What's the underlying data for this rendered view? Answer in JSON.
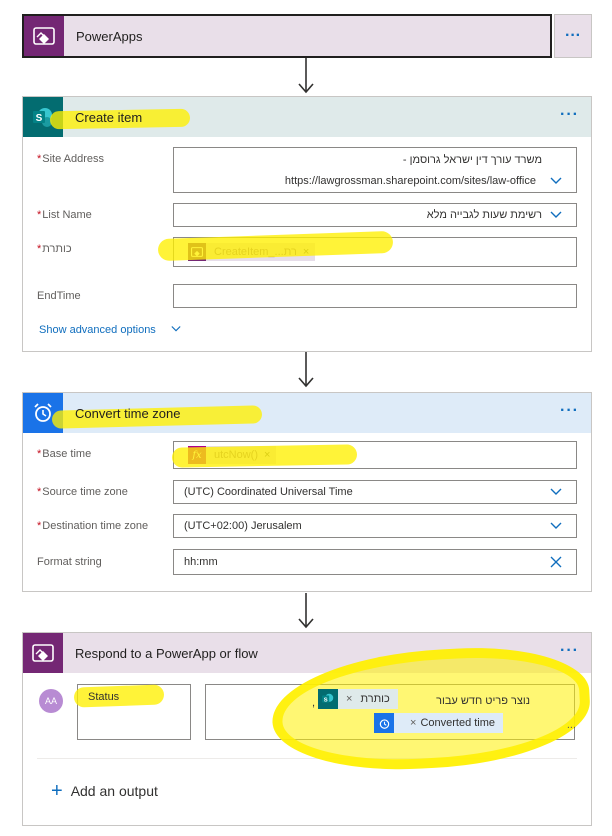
{
  "trigger": {
    "title": "PowerApps",
    "more": "···"
  },
  "create_item": {
    "title": "Create item",
    "more": "···",
    "site_address": {
      "label": "Site Address",
      "line1": "משרד עורך דין ישראל גרוסמן -",
      "line2": "https://lawgrossman.sharepoint.com/sites/law-office"
    },
    "list_name": {
      "label": "List Name",
      "value": "רשימת שעות לגבייה מלא"
    },
    "title_field": {
      "label": "כותרת",
      "token": "CreateItem_...רת"
    },
    "end_time": {
      "label": "EndTime",
      "value": ""
    },
    "advanced": "Show advanced options"
  },
  "convert_time": {
    "title": "Convert time zone",
    "more": "···",
    "base_time": {
      "label": "Base time",
      "token": "utcNow()"
    },
    "source_tz": {
      "label": "Source time zone",
      "value": "(UTC) Coordinated Universal Time"
    },
    "dest_tz": {
      "label": "Destination time zone",
      "value": "(UTC+02:00) Jerusalem"
    },
    "format": {
      "label": "Format string",
      "value": "hh:mm"
    }
  },
  "respond": {
    "title": "Respond to a PowerApp or flow",
    "more": "···",
    "avatar_text": "AA",
    "output_name": "Status",
    "output_prefix": "נוצר פריט חדש עבור",
    "output_comma": ",",
    "token1": "כותרת",
    "token2": "Converted time",
    "ellipsis": "...",
    "add_output": "Add an output"
  },
  "colors": {
    "powerapps": "#742774",
    "sharepoint": "#036c70",
    "clock": "#1a73e8",
    "expr": "#ad008c",
    "link": "#106ebe"
  }
}
